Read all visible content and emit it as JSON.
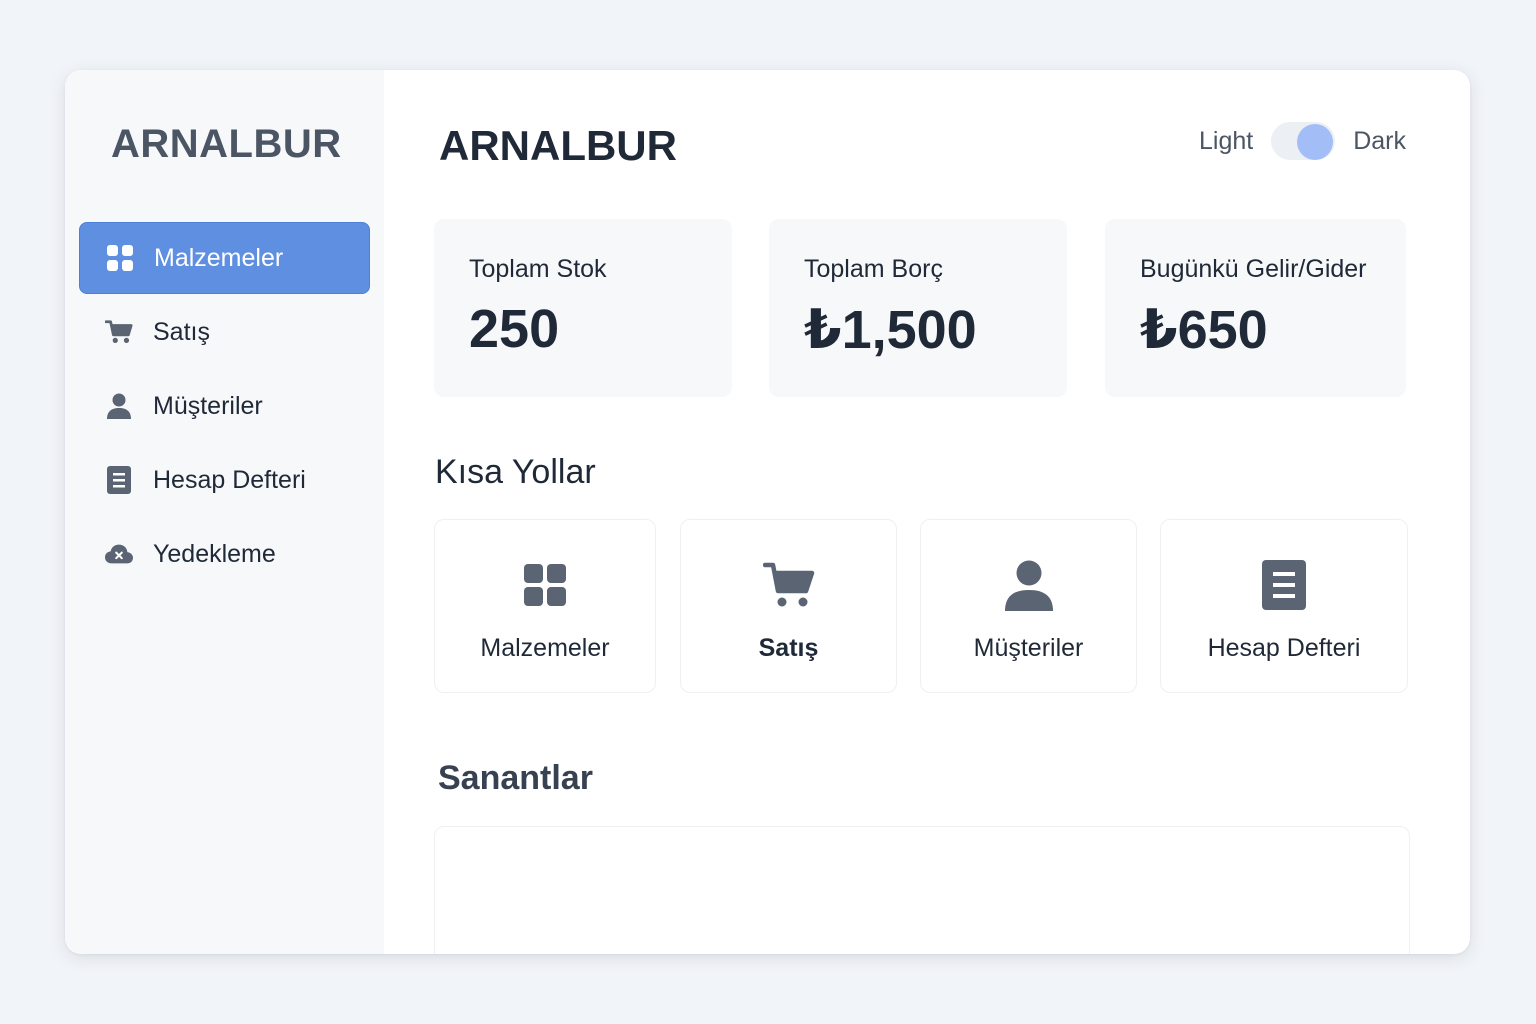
{
  "sidebar": {
    "brand": "ARNALBUR",
    "items": [
      {
        "label": "Malzemeler",
        "icon": "grid-icon",
        "active": true
      },
      {
        "label": "Satış",
        "icon": "cart-icon",
        "active": false
      },
      {
        "label": "Müşteriler",
        "icon": "user-icon",
        "active": false
      },
      {
        "label": "Hesap Defteri",
        "icon": "ledger-icon",
        "active": false
      },
      {
        "label": "Yedekleme",
        "icon": "cloud-backup-icon",
        "active": false
      }
    ]
  },
  "header": {
    "title": "ARNALBUR",
    "theme_light_label": "Light",
    "theme_dark_label": "Dark",
    "theme": "dark"
  },
  "stats": [
    {
      "label": "Toplam Stok",
      "value": "250"
    },
    {
      "label": "Toplam Borç",
      "value": "₺1,500"
    },
    {
      "label": "Bugünkü Gelir/Gider",
      "value": "₺650"
    }
  ],
  "shortcuts": {
    "title": "Kısa Yollar",
    "items": [
      {
        "label": "Malzemeler",
        "icon": "grid-icon"
      },
      {
        "label": "Satış",
        "icon": "cart-icon"
      },
      {
        "label": "Müşteriler",
        "icon": "user-icon"
      },
      {
        "label": "Hesap Defteri",
        "icon": "ledger-icon"
      }
    ]
  },
  "recent": {
    "title": "Sanantlar"
  },
  "colors": {
    "accent": "#5f8fe0",
    "toggle_knob": "#a3bdf7",
    "icon": "#5b6473"
  }
}
